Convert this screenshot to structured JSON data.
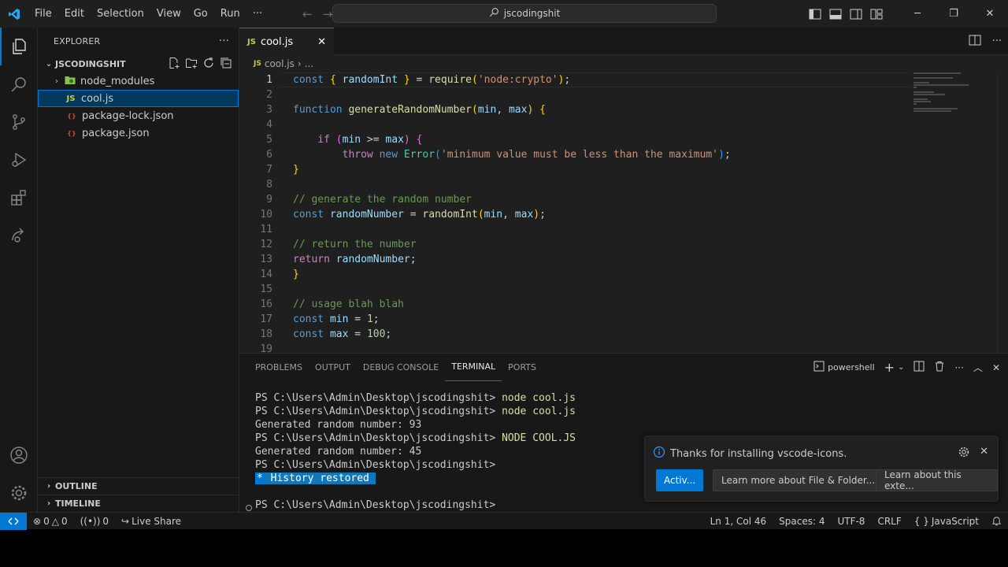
{
  "menu": [
    "File",
    "Edit",
    "Selection",
    "View",
    "Go",
    "Run",
    "···"
  ],
  "search": {
    "text": "jscodingshit"
  },
  "sidebar": {
    "header": "EXPLORER",
    "more": "···",
    "folder": "JSCODINGSHIT",
    "items": [
      {
        "name": "node_modules",
        "type": "folder"
      },
      {
        "name": "cool.js",
        "type": "js",
        "selected": true
      },
      {
        "name": "package-lock.json",
        "type": "json"
      },
      {
        "name": "package.json",
        "type": "json"
      }
    ],
    "js_badge": "JS",
    "json_badge": "{}",
    "outline": "OUTLINE",
    "timeline": "TIMELINE"
  },
  "editor": {
    "tab_label": "cool.js",
    "tab_badge": "JS",
    "breadcrumb_file": "cool.js",
    "breadcrumb_more": "...",
    "line_numbers": [
      "1",
      "2",
      "3",
      "4",
      "5",
      "6",
      "7",
      "8",
      "9",
      "10",
      "11",
      "12",
      "13",
      "14",
      "15",
      "16",
      "17",
      "18",
      "19"
    ]
  },
  "panel": {
    "tabs": [
      "PROBLEMS",
      "OUTPUT",
      "DEBUG CONSOLE",
      "TERMINAL",
      "PORTS"
    ],
    "active_tab": "TERMINAL",
    "shell": "powershell",
    "terminal": {
      "prompt": "PS C:\\Users\\Admin\\Desktop\\jscodingshit>",
      "cmd1": "node cool.js",
      "cmd2": "node cool.js",
      "out1": "Generated random number: 93",
      "cmd3": "NODE COOL.JS",
      "out2": "Generated random number: 45",
      "hist_star": "*",
      "hist_text": "History restored"
    }
  },
  "notification": {
    "message": "Thanks for installing vscode-icons.",
    "buttons": [
      "Activ...",
      "Learn more about File & Folder...",
      "Learn about this exte..."
    ]
  },
  "status": {
    "errors": "0",
    "warnings": "0",
    "ports": "0",
    "live_share": "Live Share",
    "position": "Ln 1, Col 46",
    "spaces": "Spaces: 4",
    "encoding": "UTF-8",
    "eol": "CRLF",
    "language": "JavaScript",
    "lang_braces": "{ }"
  },
  "colors": {
    "accent": "#0078d4",
    "background": "#1f1f1f",
    "sidebar": "#181818"
  }
}
